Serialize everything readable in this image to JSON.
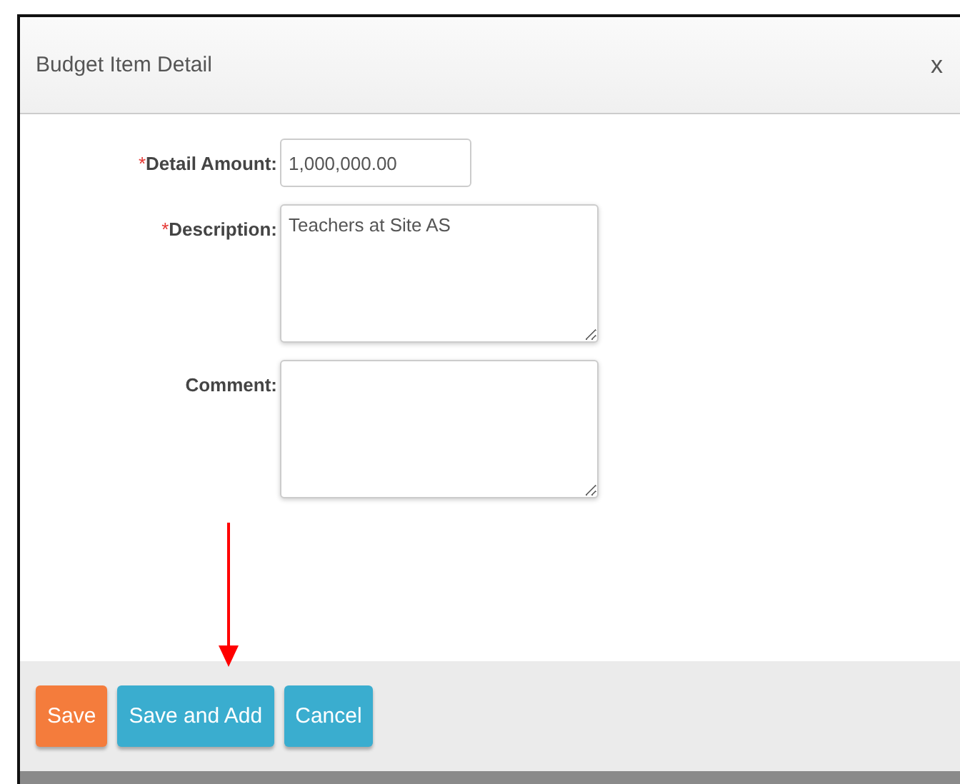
{
  "dialog": {
    "title": "Budget Item Detail",
    "close": "x"
  },
  "fields": [
    {
      "kind": "input",
      "label": "Detail Amount:",
      "required_mark": "*",
      "value": "1,000,000.00"
    },
    {
      "kind": "textarea",
      "label": "Description:",
      "required_mark": "*",
      "value": "Teachers at Site AS"
    },
    {
      "kind": "textarea",
      "label": "Comment:"
    }
  ],
  "buttons": [
    {
      "label": "Save",
      "color": "#f47c3c"
    },
    {
      "label": "Save and Add",
      "color": "#3aadcf"
    },
    {
      "label": "Cancel",
      "color": "#3aadcf"
    }
  ]
}
